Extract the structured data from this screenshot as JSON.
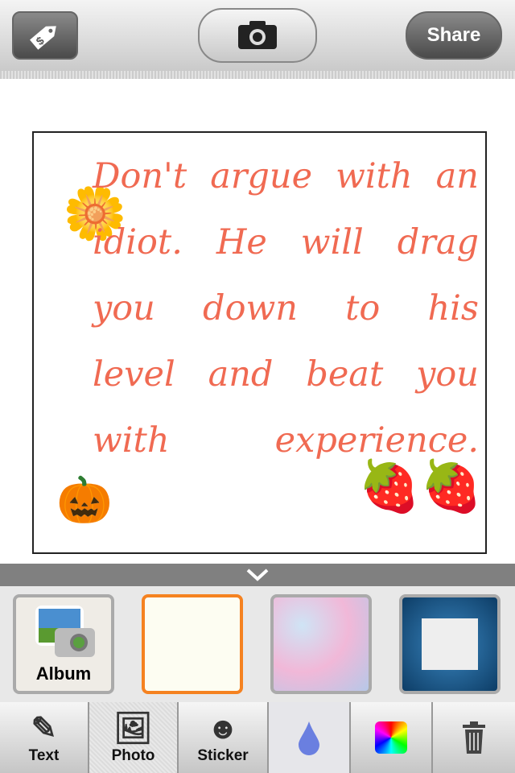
{
  "header": {
    "share_label": "Share"
  },
  "quote": {
    "text": "Don't argue with an idiot. He will drag you down to his level and beat you with experience."
  },
  "thumbnails": [
    {
      "label": "Album"
    },
    {
      "selected": true
    },
    {},
    {}
  ],
  "toolbar": {
    "items": [
      {
        "label": "Text",
        "icon": "edit-icon"
      },
      {
        "label": "Photo",
        "icon": "image-icon",
        "selected": true
      },
      {
        "label": "Sticker",
        "icon": "smiley-icon"
      },
      {
        "label": "",
        "icon": "drop-icon"
      },
      {
        "label": "",
        "icon": "color-wheel-icon"
      },
      {
        "label": "",
        "icon": "trash-icon"
      }
    ]
  },
  "colors": {
    "accent": "#f58220",
    "quote": "#f06a52",
    "drop": "#6a7fe0"
  }
}
